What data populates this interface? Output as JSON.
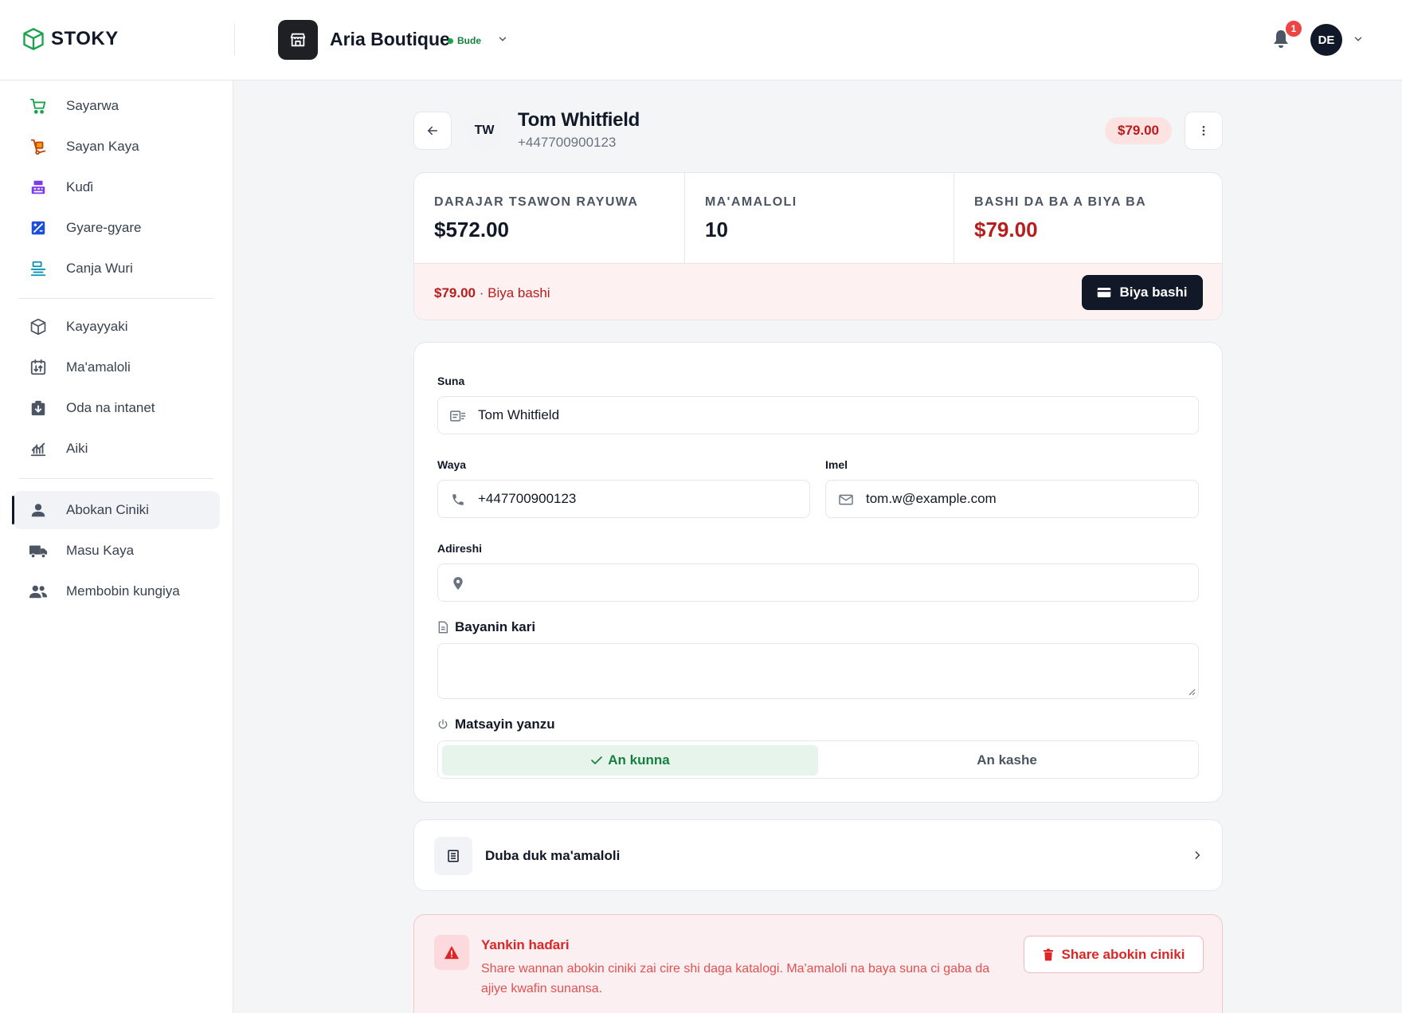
{
  "brand": {
    "name": "STOKY"
  },
  "store": {
    "name": "Aria Boutique",
    "status": "Bude"
  },
  "notifications": {
    "count": "1"
  },
  "user": {
    "initials": "DE"
  },
  "sidebar": {
    "items": [
      {
        "label": "Sayarwa",
        "icon": "cart-icon",
        "color": "#16a34a"
      },
      {
        "label": "Sayan Kaya",
        "icon": "hand-truck-icon",
        "color": "#c2410c"
      },
      {
        "label": "Kuɗi",
        "icon": "cash-register-icon",
        "color": "#7c3aed"
      },
      {
        "label": "Gyare-gyare",
        "icon": "adjust-icon",
        "color": "#1d4ed8"
      },
      {
        "label": "Canja Wuri",
        "icon": "transfer-icon",
        "color": "#0891b2"
      },
      {
        "label": "Kayayyaki",
        "icon": "box-icon",
        "color": "#4b5563"
      },
      {
        "label": "Ma'amaloli",
        "icon": "transactions-icon",
        "color": "#4b5563"
      },
      {
        "label": "Oda na intanet",
        "icon": "online-order-icon",
        "color": "#4b5563"
      },
      {
        "label": "Aiki",
        "icon": "chart-icon",
        "color": "#4b5563"
      },
      {
        "label": "Abokan Ciniki",
        "icon": "person-icon",
        "color": "#4b5563"
      },
      {
        "label": "Masu Kaya",
        "icon": "truck-icon",
        "color": "#4b5563"
      },
      {
        "label": "Membobin kungiya",
        "icon": "team-icon",
        "color": "#4b5563"
      }
    ]
  },
  "customer": {
    "initials": "TW",
    "name": "Tom Whitfield",
    "phone": "+447700900123",
    "balance": "$79.00"
  },
  "stats": [
    {
      "label": "DARAJAR TSAWON RAYUWA",
      "value": "$572.00"
    },
    {
      "label": "MA'AMALOLI",
      "value": "10"
    },
    {
      "label": "BASHI DA BA A BIYA BA",
      "value": "$79.00"
    }
  ],
  "payment": {
    "amount": "$79.00",
    "text": "· Biya bashi",
    "button": "Biya bashi"
  },
  "form": {
    "name_label": "Suna",
    "name_value": "Tom Whitfield",
    "phone_label": "Waya",
    "phone_value": "+447700900123",
    "email_label": "Imel",
    "email_value": "tom.w@example.com",
    "address_label": "Adireshi",
    "address_value": "",
    "notes_label": "Bayanin kari",
    "notes_value": "",
    "status_label": "Matsayin yanzu",
    "status_active": "An kunna",
    "status_inactive": "An kashe"
  },
  "history": {
    "label": "Duba duk ma'amaloli"
  },
  "danger": {
    "title": "Yankin haɗari",
    "text": "Share wannan abokin ciniki zai cire shi daga katalogi. Ma'amaloli na baya suna ci gaba da ajiye kwafin sunansa.",
    "button": "Share abokin ciniki"
  },
  "colors": {
    "accent_dark": "#111827",
    "danger": "#dc2626",
    "success": "#15803d"
  }
}
